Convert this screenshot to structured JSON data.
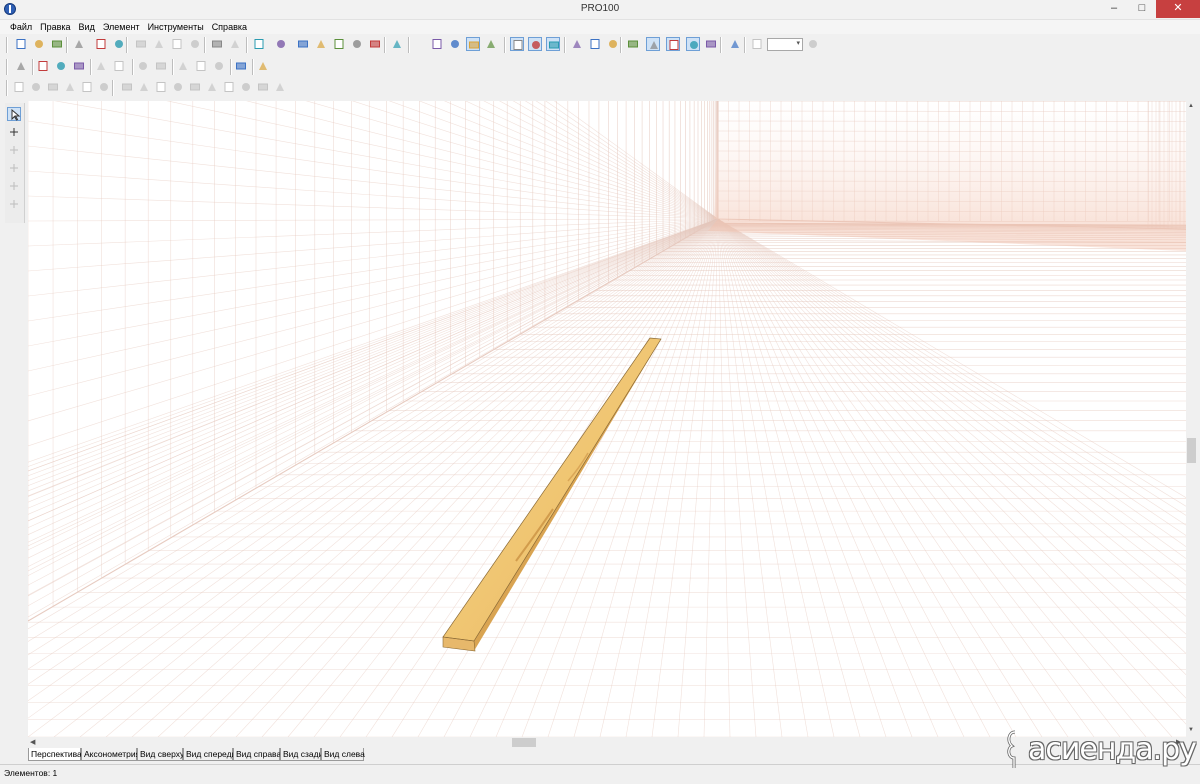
{
  "window": {
    "title": "PRO100",
    "minimize_glyph": "–",
    "maximize_glyph": "□",
    "close_glyph": "✕"
  },
  "menu": [
    "Файл",
    "Правка",
    "Вид",
    "Элемент",
    "Инструменты",
    "Справка"
  ],
  "toolbar1_icons": [
    "new-file-icon",
    "open-folder-icon",
    "save-icon",
    "properties-icon",
    "print-icon",
    "print-preview-icon",
    "cut-icon",
    "copy-icon",
    "paste-icon",
    "delete-icon",
    "undo-icon",
    "redo-icon",
    "group-icon",
    "list-icon",
    "element-1-icon",
    "element-2-icon",
    "element-3-icon",
    "element-4-icon",
    "element-5-icon",
    "sum-icon",
    "view-wire-icon",
    "view-hidden-icon",
    "view-solid-icon",
    "view-shaded-icon",
    "view-box-icon",
    "view-box-2-icon",
    "view-textured-icon",
    "dimensions-icon",
    "light-bulb-1-icon",
    "light-bulb-2-icon",
    "measure-icon",
    "ruler-icon",
    "grid-icon",
    "magnet-icon",
    "snap-icon",
    "stop-icon",
    "zoom-out-icon",
    "zoom-in-icon"
  ],
  "toolbar2_icons": [
    "select-all-icon",
    "move-vertical-icon",
    "rotate-icon",
    "pencil-icon",
    "scale-icon",
    "scale-2-icon",
    "mirror-vertical-icon",
    "mirror-horizontal-icon",
    "rotate-element-icon",
    "move-cross-icon",
    "move-up-icon",
    "edge-icon",
    "delete-element-icon"
  ],
  "toolbar3_icons": [
    "align-left-icon",
    "align-center-icon",
    "align-top-icon",
    "align-stack-icon",
    "align-right-icon",
    "align-bottom-icon",
    "distribute-h-icon",
    "distribute-v-icon",
    "distribute-3-icon",
    "distribute-4-icon",
    "align-5-icon",
    "align-6-icon",
    "align-7-icon",
    "align-8-icon",
    "align-9-icon",
    "align-10-icon"
  ],
  "left_tools": [
    "select-arrow-icon",
    "explode-icon",
    "page-icon",
    "dimension-icon",
    "edit-icon",
    "zoom-tool-icon"
  ],
  "zoom_value": "",
  "view_tabs": [
    "Перспектива",
    "Аксонометрия",
    "Вид сверху",
    "Вид спереди",
    "Вид справа",
    "Вид сзади",
    "Вид слева"
  ],
  "active_tab": "Перспектива",
  "status": "Элементов: 1",
  "watermark": "асиенда.ру",
  "colors": {
    "grid": "#e5c8bd",
    "board": "#f2c87a",
    "board_dark": "#cf9a44"
  }
}
